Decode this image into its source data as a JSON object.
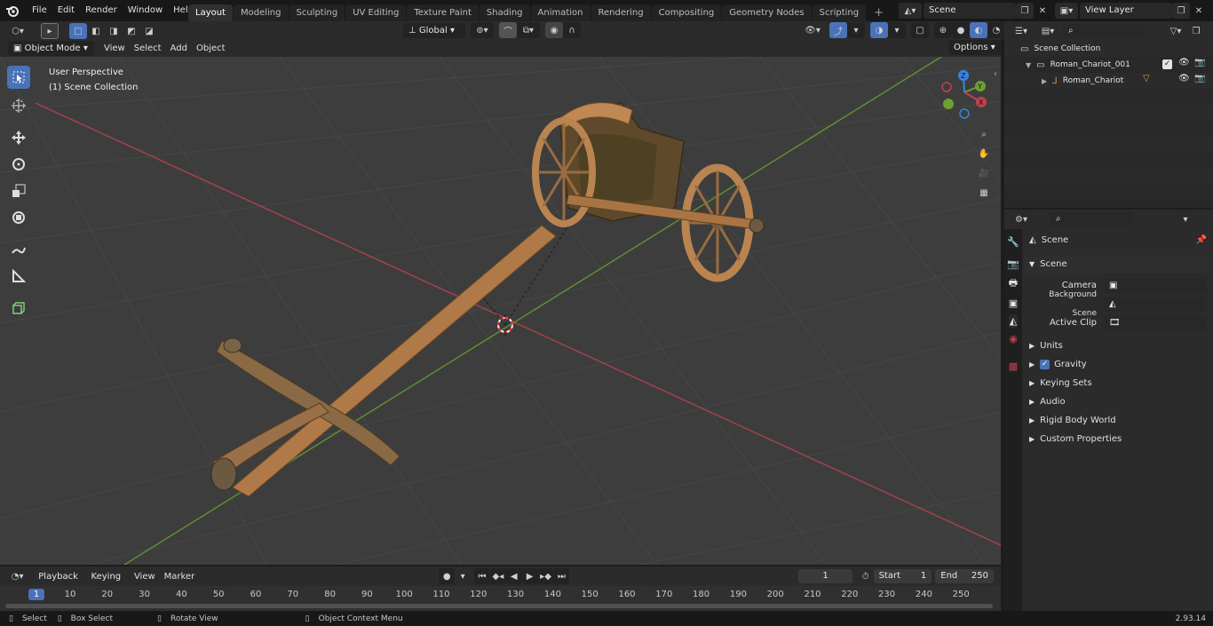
{
  "topbar": {
    "menus": [
      "File",
      "Edit",
      "Render",
      "Window",
      "Help"
    ],
    "workspaces": [
      "Layout",
      "Modeling",
      "Sculpting",
      "UV Editing",
      "Texture Paint",
      "Shading",
      "Animation",
      "Rendering",
      "Compositing",
      "Geometry Nodes",
      "Scripting"
    ],
    "active_workspace": "Layout",
    "scene_name": "Scene",
    "view_layer": "View Layer"
  },
  "viewport_header": {
    "mode": "Object Mode",
    "menus": [
      "View",
      "Select",
      "Add",
      "Object"
    ],
    "orientation": "Global",
    "options": "Options"
  },
  "viewport": {
    "perspective_label": "User Perspective",
    "collection_label": "(1) Scene Collection",
    "gizmo_axes": [
      "X",
      "Y",
      "Z"
    ]
  },
  "outliner": {
    "root": "Scene Collection",
    "items": [
      {
        "name": "Roman_Chariot_001"
      },
      {
        "name": "Roman_Chariot"
      }
    ]
  },
  "properties": {
    "context_label": "Scene",
    "panel_title": "Scene",
    "fields": [
      {
        "label": "Camera"
      },
      {
        "label": "Background Scene"
      },
      {
        "label": "Active Clip"
      }
    ],
    "sections": [
      "Units",
      "Gravity",
      "Keying Sets",
      "Audio",
      "Rigid Body World",
      "Custom Properties"
    ]
  },
  "timeline": {
    "menus": [
      "Playback",
      "Keying",
      "View",
      "Marker"
    ],
    "current_frame": "1",
    "start_label": "Start",
    "start": "1",
    "end_label": "End",
    "end": "250",
    "ruler": [
      "1",
      "10",
      "20",
      "30",
      "40",
      "50",
      "60",
      "70",
      "80",
      "90",
      "100",
      "110",
      "120",
      "130",
      "140",
      "150",
      "160",
      "170",
      "180",
      "190",
      "200",
      "210",
      "220",
      "230",
      "240",
      "250"
    ]
  },
  "statusbar": {
    "hints": [
      "Select",
      "Box Select",
      "Rotate View",
      "Object Context Menu"
    ],
    "version": "2.93.14"
  },
  "colors": {
    "accent": "#4a72b8",
    "x_axis": "#c4404f",
    "y_axis": "#6ca033",
    "z_axis": "#3a84e0"
  }
}
